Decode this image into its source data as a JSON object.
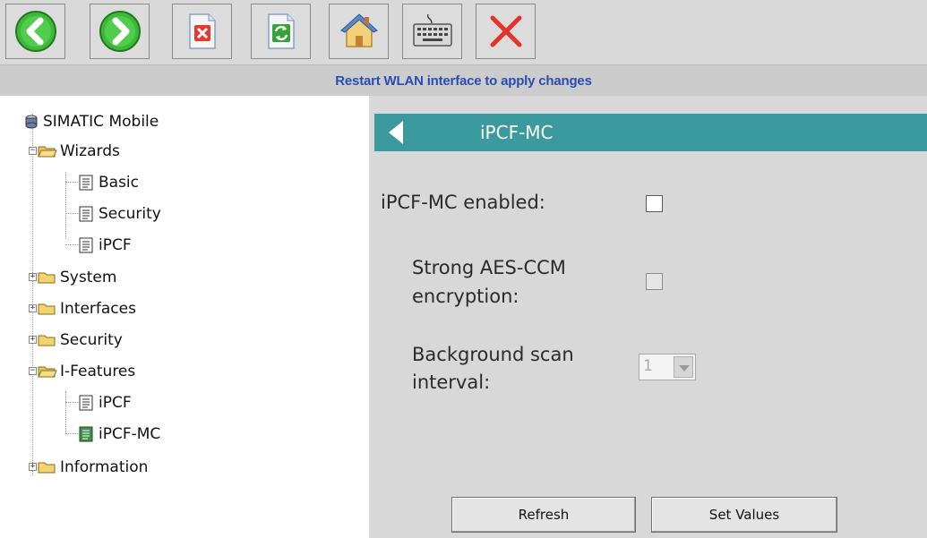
{
  "toolbar": {
    "buttons": [
      {
        "icon": "back-arrow-icon"
      },
      {
        "icon": "forward-arrow-icon"
      },
      {
        "icon": "discard-document-icon"
      },
      {
        "icon": "reload-document-icon"
      },
      {
        "icon": "home-icon"
      },
      {
        "icon": "keyboard-icon"
      },
      {
        "icon": "close-icon"
      }
    ]
  },
  "status": {
    "message": "Restart WLAN interface to apply changes",
    "color": "#2a4db3"
  },
  "tree": {
    "root": "SIMATIC Mobile",
    "wizards": "Wizards",
    "basic": "Basic",
    "security_wizard": "Security",
    "ipcf_wizard": "iPCF",
    "system": "System",
    "interfaces": "Interfaces",
    "security": "Security",
    "ifeatures": "I-Features",
    "ipcf": "iPCF",
    "ipcf_mc": "iPCF-MC",
    "information": "Information"
  },
  "panel": {
    "title": "iPCF-MC",
    "header_color": "#3a9a9e",
    "enabled_label": "iPCF-MC enabled:",
    "enabled_checked": false,
    "aes_label_1": "Strong AES-CCM",
    "aes_label_2": "encryption:",
    "aes_checked": false,
    "scan_label_1": "Background scan",
    "scan_label_2": "interval:",
    "scan_value": "1",
    "refresh": "Refresh",
    "set_values": "Set Values"
  }
}
